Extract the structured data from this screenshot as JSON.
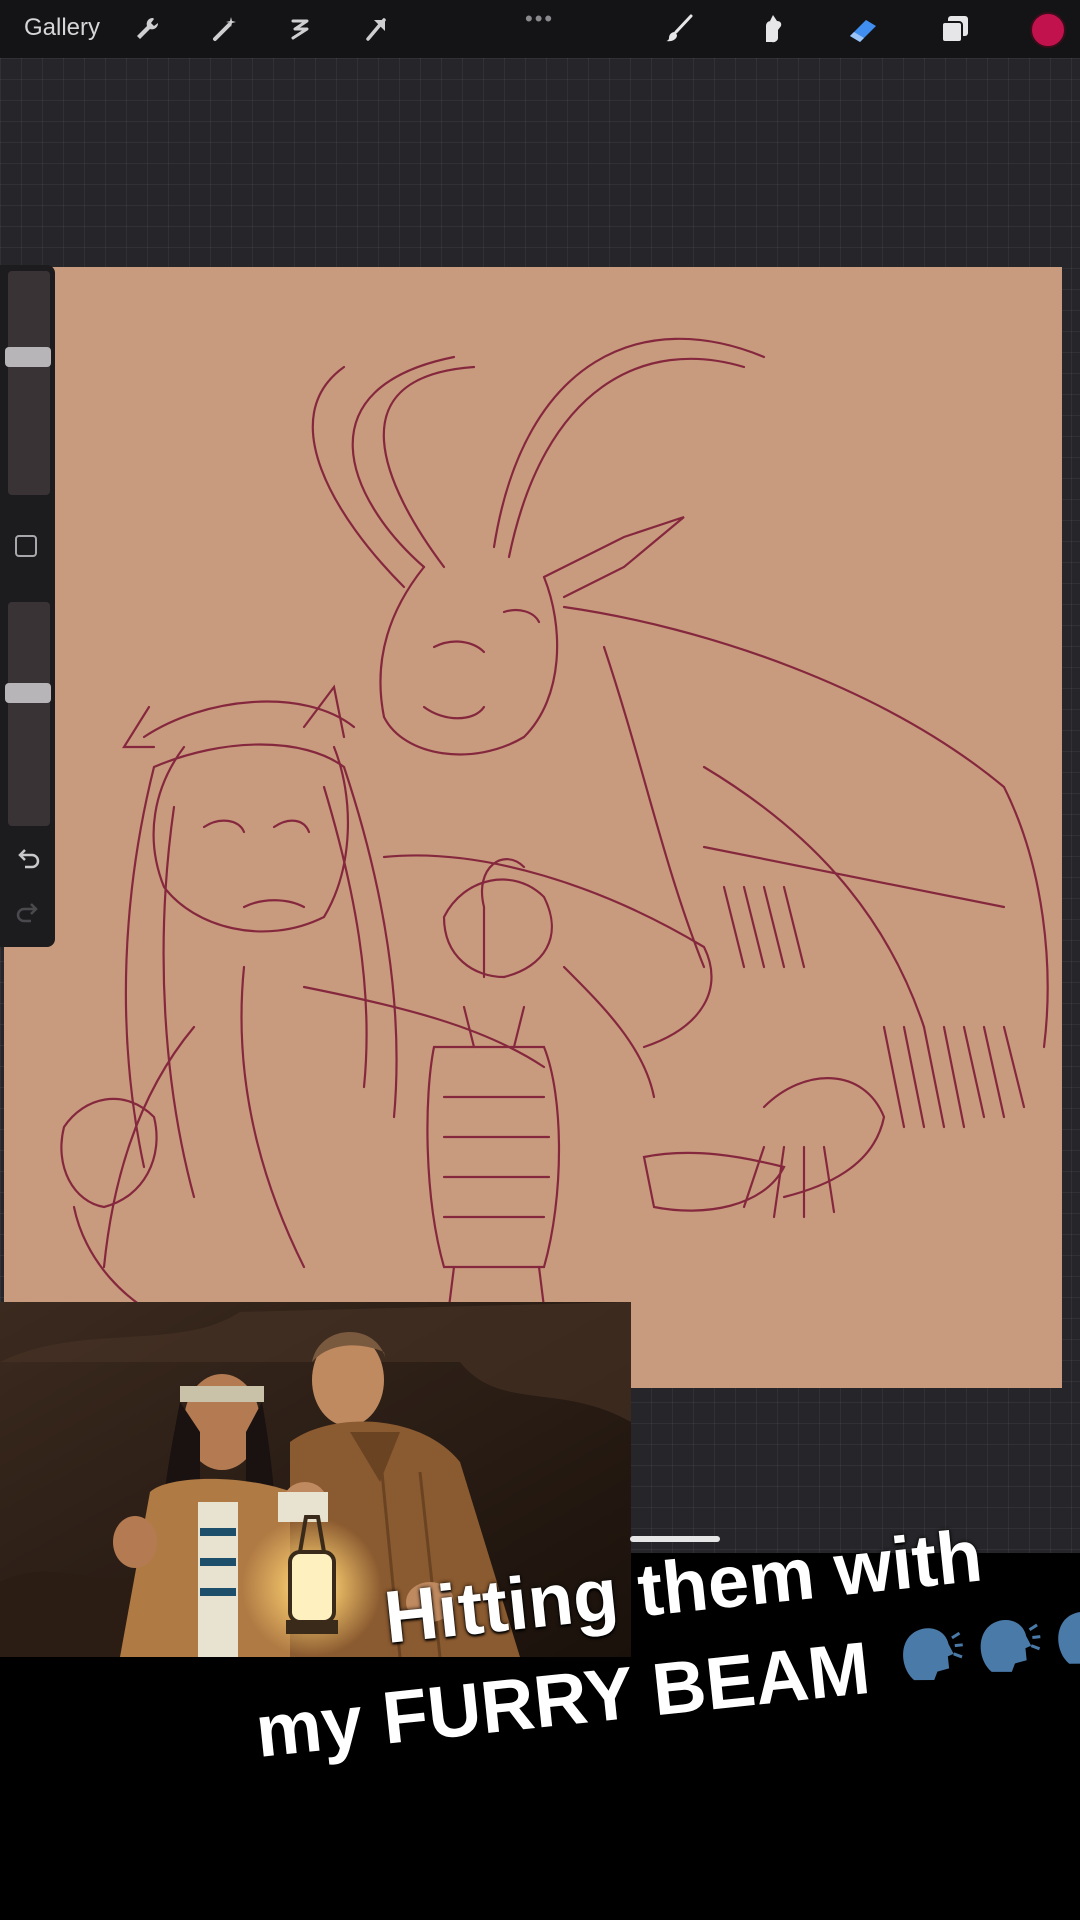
{
  "toolbar": {
    "gallery_label": "Gallery",
    "left_icons": [
      "wrench-icon",
      "magic-wand-icon",
      "selection-icon",
      "transform-arrow-icon"
    ],
    "more_dots": "•••",
    "right_icons": [
      "brush-icon",
      "smudge-icon",
      "eraser-icon",
      "layers-icon"
    ],
    "active_color": "#c2124e"
  },
  "sidebar": {
    "icons": [
      "modify-square-icon",
      "undo-icon",
      "redo-icon"
    ]
  },
  "canvas": {
    "background": "#c99b7e",
    "sketch_color": "#7a1434"
  },
  "reference_photo": {
    "icon": "reference-photo-icon"
  },
  "caption": {
    "line1": "Hitting them with",
    "line2": "my FURRY BEAM",
    "emoji": "speaking-head-icon"
  }
}
